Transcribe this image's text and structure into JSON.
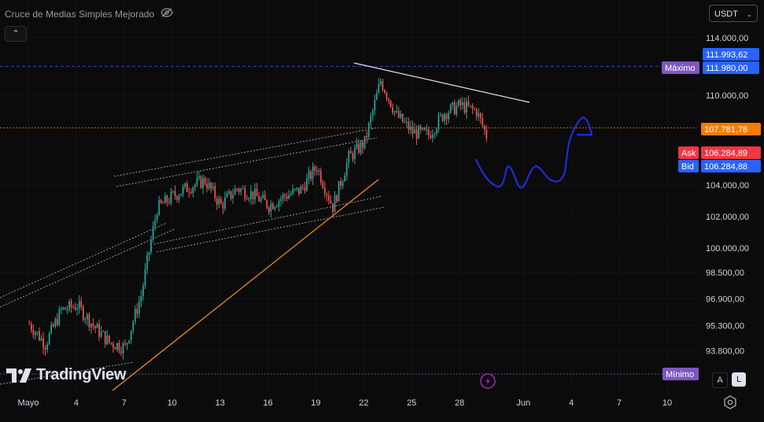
{
  "indicator": {
    "name": "Cruce de Medias Simples Mejorado",
    "icon": "eye-off-icon"
  },
  "toolbar": {
    "collapse_icon": "chevron-up-icon",
    "currency": "USDT",
    "currency_icon": "chevron-down-icon"
  },
  "logo": {
    "text": "TradingView",
    "icon": "tradingview-logo-icon"
  },
  "scale_buttons": {
    "auto": "A",
    "log": "L"
  },
  "settings_icon": "gear-icon",
  "replay_icon": "lightning-icon",
  "colors": {
    "up": "#26a69a",
    "down": "#ef5350",
    "price_orange": "#f57c00",
    "bid_blue": "#2962ff",
    "ask_red": "#f23645",
    "max_purple": "#7e57c2",
    "trendline_orange": "#f7931a",
    "drawing_blue": "#1e2bdb"
  },
  "chart_data": {
    "type": "candlestick",
    "title": "",
    "xlabel": "",
    "ylabel": "",
    "y_axis": {
      "position": "right",
      "scale": "log",
      "ylim": [
        92900,
        116500
      ],
      "tick_values": [
        93800,
        95300,
        96900,
        98500,
        100000,
        102000,
        104000,
        110000,
        114000
      ],
      "tick_labels": [
        "93.800,00",
        "95.300,00",
        "96.900,00",
        "98.500,00",
        "100.000,00",
        "102.000,00",
        "104.000,00",
        "110.000,00",
        "114.000,00"
      ]
    },
    "x_axis": {
      "tick_labels": [
        "Mayo",
        "4",
        "7",
        "10",
        "13",
        "16",
        "19",
        "22",
        "25",
        "28",
        "Jun",
        "4",
        "7",
        "10"
      ],
      "tick_index": [
        0,
        3,
        6,
        9,
        12,
        15,
        18,
        21,
        24,
        27,
        31,
        34,
        37,
        40
      ]
    },
    "bars_per_day": 8,
    "daily_closes": [
      94200,
      96200,
      96500,
      95300,
      94300,
      94000,
      97100,
      102500,
      103300,
      103900,
      104300,
      102700,
      103800,
      103400,
      102700,
      103300,
      103700,
      105200,
      102600,
      105800,
      106800,
      111000,
      108600,
      107500,
      107300,
      108800,
      109300,
      108900,
      106300
    ],
    "price_lines": [
      {
        "label": "Máximo",
        "value_label": "111.993,62",
        "value": 111993.62,
        "color": "#2962ff",
        "style": "dashed"
      },
      {
        "label": "",
        "value_label": "111.980,00",
        "value": 111980,
        "color": "#2962ff",
        "style": "none"
      },
      {
        "label": "",
        "value_label": "107.781,78",
        "value": 107781.78,
        "color": "#f57c00",
        "style": "dotted"
      },
      {
        "label": "Ask",
        "value_label": "106.284,89",
        "value": 106284.89,
        "color": "#f23645",
        "style": "none"
      },
      {
        "label": "Bid",
        "value_label": "106.284,88",
        "value": 106284.88,
        "color": "#2962ff",
        "style": "none"
      },
      {
        "label": "Mínimo",
        "value_label": "",
        "value": 93350,
        "color": "#7e57c2",
        "style": "dotted"
      }
    ]
  }
}
